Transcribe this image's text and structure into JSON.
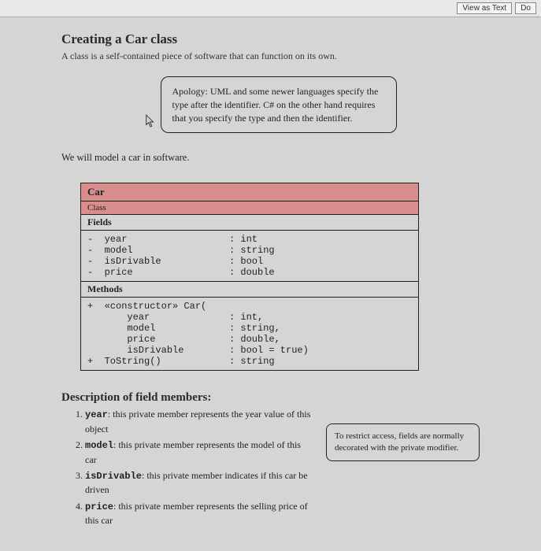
{
  "toolbar": {
    "view_as_text": "View as Text",
    "do": "Do"
  },
  "heading": "Creating a Car class",
  "lead": "A class is a self-contained piece of software that can function on its own.",
  "apology": "Apology: UML and some newer languages specify the type after the identifier. C# on the other hand requires that you specify the type and then the identifier.",
  "modeling": "We will model a car in software.",
  "uml": {
    "class_name": "Car",
    "stereotype": "Class",
    "fields_label": "Fields",
    "fields": [
      {
        "name": "-  year",
        "type": ": int"
      },
      {
        "name": "-  model",
        "type": ": string"
      },
      {
        "name": "-  isDrivable",
        "type": ": bool"
      },
      {
        "name": "-  price",
        "type": ": double"
      }
    ],
    "methods_label": "Methods",
    "methods": [
      {
        "left": "+  «constructor» Car(",
        "right": ""
      },
      {
        "left": "       year",
        "right": ": int,"
      },
      {
        "left": "       model",
        "right": ": string,"
      },
      {
        "left": "       price",
        "right": ": double,"
      },
      {
        "left": "       isDrivable",
        "right": ": bool = true)"
      },
      {
        "left": "+  ToString()",
        "right": ": string"
      }
    ]
  },
  "desc_heading": "Description of field members:",
  "desc": [
    {
      "term": "year",
      "text": ": this private member represents the year value of this object"
    },
    {
      "term": "model",
      "text": ": this private member represents the model of this car"
    },
    {
      "term": "isDrivable",
      "text": ": this private member indicates if this car be driven"
    },
    {
      "term": "price",
      "text": ": this private member represents the selling price of this car"
    }
  ],
  "aside": "To restrict access, fields are normally decorated with the private modifier."
}
